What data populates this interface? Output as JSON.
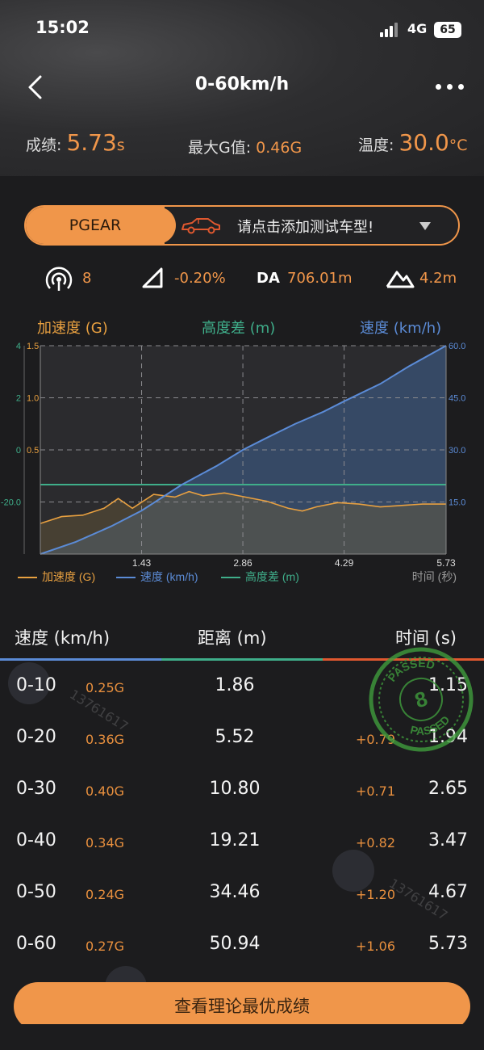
{
  "status": {
    "time": "15:02",
    "network": "4G",
    "battery": "65"
  },
  "nav": {
    "title": "0-60km/h",
    "back_icon": "chevron-left-icon",
    "more_icon": "more-dots-icon"
  },
  "stats": {
    "score_label": "成绩:",
    "score_value": "5.73",
    "score_unit": "s",
    "maxg_label": "最大G值:",
    "maxg_value": "0.46",
    "maxg_unit": "G",
    "temp_label": "温度:",
    "temp_value": "30.0",
    "temp_unit": "°C"
  },
  "pill": {
    "brand": "PGEAR",
    "prompt": "请点击添加测试车型!",
    "car_icon": "car-icon",
    "dropdown_icon": "triangle-down-icon"
  },
  "metrics": {
    "satellites": "8",
    "slope": "-0.20%",
    "da_label": "DA",
    "da_value": "706.01m",
    "elevation": "4.2m"
  },
  "chart_labels": {
    "accel": "加速度 (G)",
    "alt": "高度差 (m)",
    "speed": "速度 (km/h)"
  },
  "chart_data": {
    "type": "line",
    "x_ticks": [
      "1.43",
      "2.86",
      "4.29",
      "5.73"
    ],
    "x_axis_label": "时间 (秒)",
    "left_outer_ticks": [
      "4",
      "2",
      "0",
      "-20.0"
    ],
    "left_inner_ticks": [
      "1.5",
      "1.0",
      "0.5"
    ],
    "right_ticks": [
      "60.0",
      "45.0",
      "30.0",
      "15.0"
    ],
    "xlim": [
      0,
      5.73
    ],
    "ylim_speed": [
      0,
      60
    ],
    "series": [
      {
        "name": "速度 (km/h)",
        "color": "#5b8bd6",
        "axis": "right",
        "x": [
          0,
          0.5,
          1.0,
          1.43,
          2.0,
          2.5,
          2.86,
          3.2,
          3.6,
          4.0,
          4.29,
          4.8,
          5.2,
          5.73
        ],
        "values": [
          0,
          3.5,
          8,
          12.5,
          20,
          25.5,
          30,
          33.5,
          37.5,
          41,
          44,
          49,
          54,
          60
        ]
      },
      {
        "name": "加速度 (G)",
        "color": "#e8a040",
        "axis": "left_inner",
        "x": [
          0,
          0.3,
          0.6,
          0.9,
          1.1,
          1.3,
          1.6,
          1.9,
          2.1,
          2.3,
          2.6,
          2.9,
          3.2,
          3.5,
          3.7,
          3.9,
          4.2,
          4.5,
          4.8,
          5.1,
          5.4,
          5.73
        ],
        "values": [
          0.22,
          0.27,
          0.28,
          0.33,
          0.4,
          0.33,
          0.43,
          0.41,
          0.45,
          0.42,
          0.44,
          0.41,
          0.38,
          0.33,
          0.31,
          0.34,
          0.37,
          0.36,
          0.34,
          0.35,
          0.36,
          0.36
        ]
      },
      {
        "name": "高度差 (m)",
        "color": "#3fae8a",
        "axis": "left_inner",
        "x": [
          0,
          1.43,
          2.86,
          4.29,
          5.73
        ],
        "values": [
          0.5,
          0.5,
          0.5,
          0.5,
          0.5
        ]
      }
    ],
    "legend": [
      "加速度 (G)",
      "速度 (km/h)",
      "高度差 (m)"
    ],
    "legend_position": "bottom",
    "grid": true
  },
  "table": {
    "headers": {
      "speed": "速度 (km/h)",
      "distance": "距离 (m)",
      "time": "时间 (s)"
    },
    "header_colors": [
      "#5b8bd6",
      "#3fae8a",
      "#e0582f"
    ],
    "rows": [
      {
        "range": "0-10",
        "g": "0.25G",
        "distance": "1.86",
        "delta": "",
        "time": "1.15"
      },
      {
        "range": "0-20",
        "g": "0.36G",
        "distance": "5.52",
        "delta": "+0.79",
        "time": "1.94"
      },
      {
        "range": "0-30",
        "g": "0.40G",
        "distance": "10.80",
        "delta": "+0.71",
        "time": "2.65"
      },
      {
        "range": "0-40",
        "g": "0.34G",
        "distance": "19.21",
        "delta": "+0.82",
        "time": "3.47"
      },
      {
        "range": "0-50",
        "g": "0.24G",
        "distance": "34.46",
        "delta": "+1.20",
        "time": "4.67"
      },
      {
        "range": "0-60",
        "g": "0.27G",
        "distance": "50.94",
        "delta": "+1.06",
        "time": "5.73"
      }
    ]
  },
  "stamp": {
    "text_top": "PASSED",
    "text_bottom": "PASSED",
    "number": "8"
  },
  "watermark": {
    "text": "13761617"
  },
  "cta": {
    "label": "查看理论最优成绩"
  }
}
